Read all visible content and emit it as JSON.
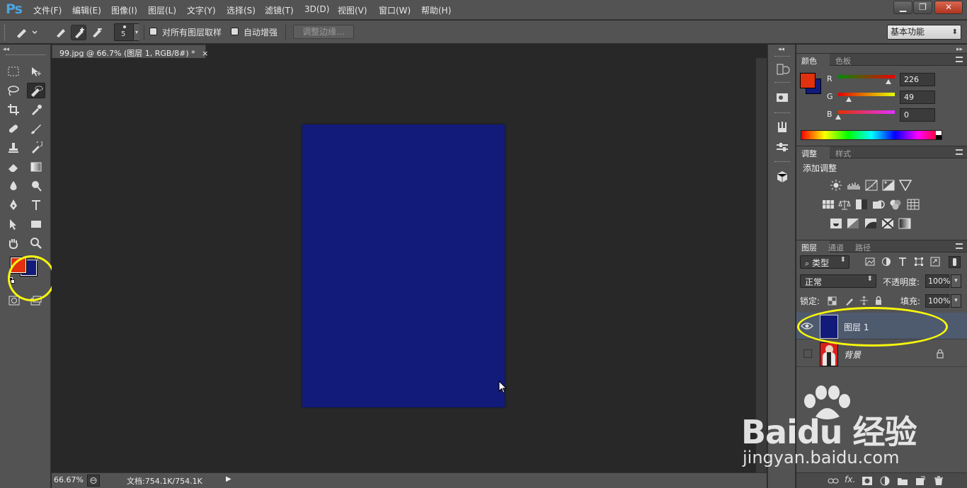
{
  "app": {
    "logo": "Ps"
  },
  "menu": [
    "文件(F)",
    "编辑(E)",
    "图像(I)",
    "图层(L)",
    "文字(Y)",
    "选择(S)",
    "滤镜(T)",
    "3D(D)",
    "视图(V)",
    "窗口(W)",
    "帮助(H)"
  ],
  "window_controls": {
    "minimize": "▁",
    "restore": "❐",
    "close": "✕"
  },
  "options": {
    "brush_size": "5",
    "sample_all_layers": "对所有图层取样",
    "auto_enhance": "自动增强",
    "refine_edge": "调整边缘...",
    "workspace": "基本功能"
  },
  "document": {
    "tab_title": "99.jpg @ 66.7% (图层 1, RGB/8#) *",
    "tab_close": "×",
    "canvas_color": "#121b7a",
    "zoom": "66.67%",
    "doc_info": "文档:754.1K/754.1K"
  },
  "toolbox": {
    "foreground_color": "#e2310e",
    "background_color": "#121b7a"
  },
  "panels": {
    "color": {
      "tabs": [
        "颜色",
        "色板"
      ],
      "channels": [
        {
          "label": "R",
          "value": "226",
          "level": 226
        },
        {
          "label": "G",
          "value": "49",
          "level": 49
        },
        {
          "label": "B",
          "value": "0",
          "level": 0
        }
      ]
    },
    "adjustments": {
      "tabs": [
        "调整",
        "样式"
      ],
      "title": "添加调整"
    },
    "layers": {
      "tabs": [
        "图层",
        "通道",
        "路径"
      ],
      "filter_kind": "类型",
      "blend_mode": "正常",
      "opacity_label": "不透明度:",
      "opacity": "100%",
      "lock_label": "锁定:",
      "fill_label": "填充:",
      "fill": "100%",
      "items": [
        {
          "name": "图层 1",
          "thumb_color": "#121b7a",
          "visible": true,
          "selected": true
        },
        {
          "name": "背景",
          "visible": false,
          "selected": false
        }
      ]
    }
  },
  "watermark": {
    "brand": "Baidu 经验",
    "url": "jingyan.baidu.com"
  },
  "colors": {
    "ui_panel": "#535353",
    "ui_dark": "#282828",
    "highlight_annotation": "#f7f70e",
    "selected_layer": "#4e5a6e"
  }
}
